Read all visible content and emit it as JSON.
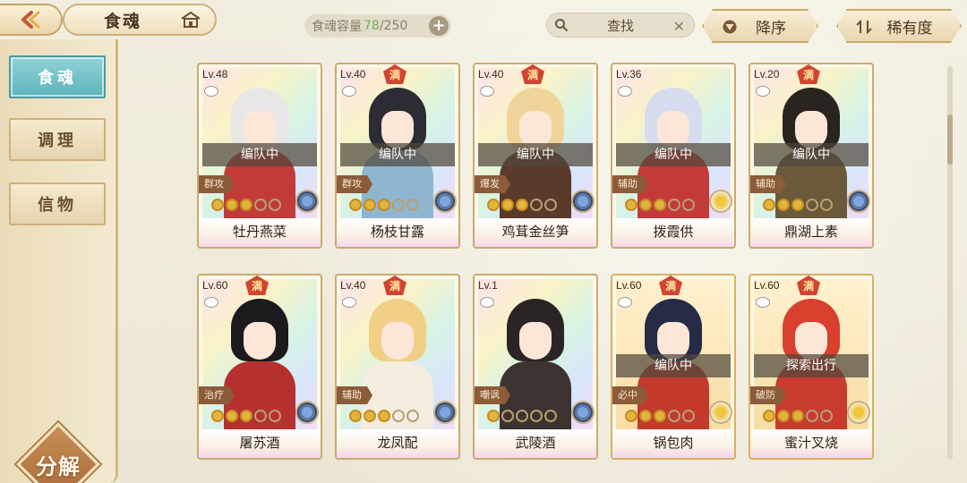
{
  "header": {
    "title": "食魂",
    "capacity_label": "食魂容量",
    "capacity_current": "78",
    "capacity_max": "/250",
    "capacity_add": "+",
    "search_placeholder": "查找",
    "search_clear": "✕",
    "sort_order_label": "降序",
    "sort_key_label": "稀有度"
  },
  "sidebar": {
    "tabs": [
      {
        "label": "食魂",
        "active": true
      },
      {
        "label": "调理",
        "active": false
      },
      {
        "label": "信物",
        "active": false
      }
    ],
    "decompose_label": "分解"
  },
  "cards": [
    {
      "level": "Lv.48",
      "name": "牡丹燕菜",
      "full": false,
      "status": "编队中",
      "role": "群攻",
      "stars": 3,
      "element": "blue",
      "hair": "#e8e6e6",
      "outfit": "#c23b3b"
    },
    {
      "level": "Lv.40",
      "name": "杨枝甘露",
      "full": true,
      "badge": "满",
      "status": "编队中",
      "role": "群攻",
      "stars": 3,
      "element": "blue",
      "hair": "#2c2c35",
      "outfit": "#8fb6cf"
    },
    {
      "level": "Lv.40",
      "name": "鸡茸金丝笋",
      "full": true,
      "badge": "满",
      "status": "编队中",
      "role": "爆发",
      "stars": 3,
      "element": "blue",
      "hair": "#f0d59a",
      "outfit": "#5a3a2a"
    },
    {
      "level": "Lv.36",
      "name": "拨霞供",
      "full": false,
      "status": "编队中",
      "role": "辅助",
      "stars": 3,
      "element": "yellow",
      "hair": "#d8dcef",
      "outfit": "#c43a3a"
    },
    {
      "level": "Lv.20",
      "name": "鼎湖上素",
      "full": true,
      "badge": "满",
      "status": "编队中",
      "role": "辅助",
      "stars": 3,
      "element": "blue",
      "hair": "#2a2420",
      "outfit": "#6a5a3a"
    },
    {
      "level": "Lv.60",
      "name": "屠苏酒",
      "full": true,
      "badge": "满",
      "status": "",
      "role": "治疗",
      "stars": 3,
      "element": "blue",
      "hair": "#1c1a1c",
      "outfit": "#b63030"
    },
    {
      "level": "Lv.40",
      "name": "龙凤配",
      "full": true,
      "badge": "满",
      "status": "",
      "role": "辅助",
      "stars": 3,
      "element": "blue",
      "hair": "#f1cf86",
      "outfit": "#f4ede0"
    },
    {
      "level": "Lv.1",
      "name": "武陵酒",
      "full": false,
      "status": "",
      "role": "嘲讽",
      "stars": 1,
      "element": "blue",
      "hair": "#2b2424",
      "outfit": "#3c3230"
    },
    {
      "level": "Lv.60",
      "name": "锅包肉",
      "full": true,
      "badge": "满",
      "status": "编队中",
      "role": "必中",
      "stars": 3,
      "element": "yellow",
      "hair": "#252b45",
      "outfit": "#c33a2c",
      "gold": true
    },
    {
      "level": "Lv.60",
      "name": "蜜汁叉烧",
      "full": true,
      "badge": "满",
      "status": "探索出行",
      "role": "破防",
      "stars": 3,
      "element": "yellow",
      "hair": "#d8402d",
      "outfit": "#c83b2e",
      "gold": true
    }
  ]
}
